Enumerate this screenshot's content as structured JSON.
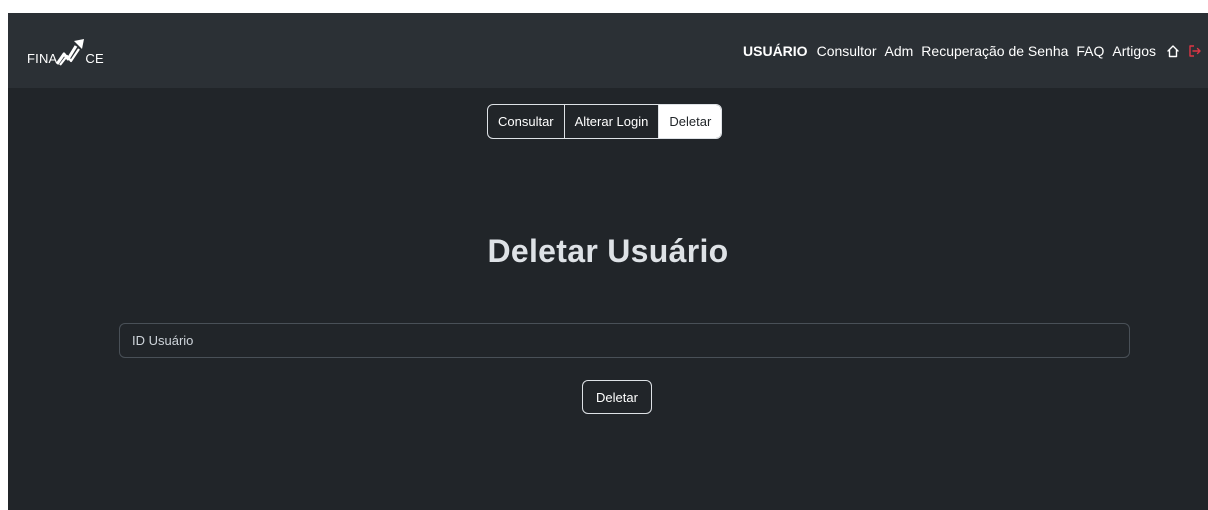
{
  "brand": {
    "logo_left": "FINA",
    "logo_right": "CE"
  },
  "nav": {
    "links": [
      "USUÁRIO",
      "Consultor",
      "Adm",
      "Recuperação de Senha",
      "FAQ",
      "Artigos"
    ],
    "active_index": 0,
    "icons": [
      "home-icon",
      "logout-icon"
    ],
    "logout_color": "#dc3545"
  },
  "tabs": {
    "items": [
      "Consultar",
      "Alterar Login",
      "Deletar"
    ],
    "active_index": 2
  },
  "main": {
    "title": "Deletar Usuário",
    "input_placeholder": "ID Usuário",
    "input_value": "",
    "submit_label": "Deletar"
  },
  "colors": {
    "background": "#212529",
    "navbar": "#2b3035",
    "text": "#ffffff"
  }
}
